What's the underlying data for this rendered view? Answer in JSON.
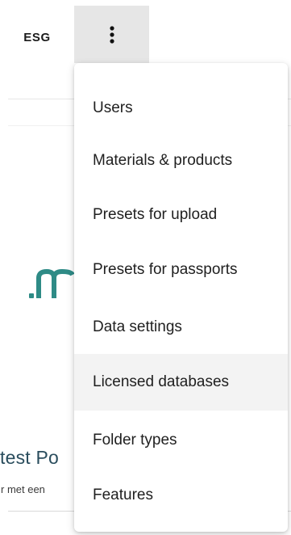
{
  "nav": {
    "tab_label": "ESG",
    "more_icon": "vertical-dots-icon"
  },
  "background": {
    "card_title": "test Po",
    "card_subtitle": "r met een",
    "logo_text_partial": ".m"
  },
  "menu": {
    "items": [
      {
        "label": "Users"
      },
      {
        "label": "Materials & products"
      },
      {
        "label": "Presets for upload"
      },
      {
        "label": "Presets for passports"
      },
      {
        "label": "Data settings"
      },
      {
        "label": "Licensed databases",
        "hovered": true
      },
      {
        "label": "Folder types"
      },
      {
        "label": "Features"
      }
    ]
  },
  "colors": {
    "logo_teal": "#2e8b86",
    "card_title": "#2a4d5d",
    "menu_hover_bg": "#f3f3f3",
    "active_button_bg": "#e6e6e6"
  }
}
